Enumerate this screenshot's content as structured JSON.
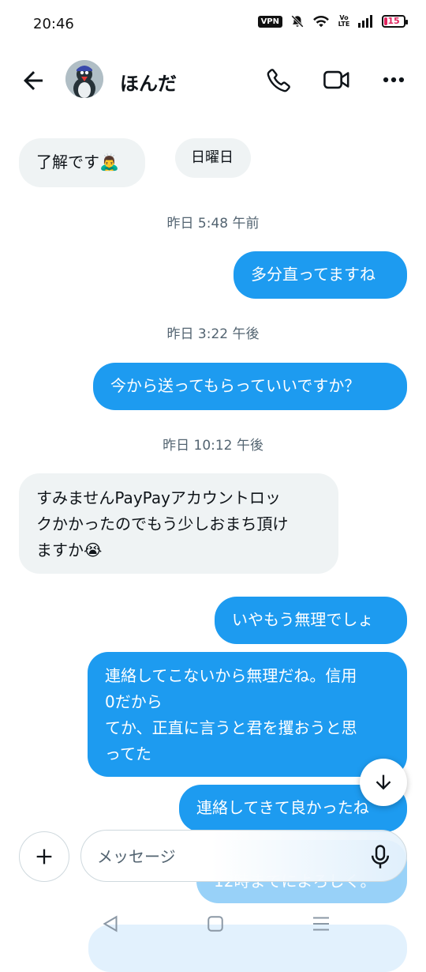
{
  "status_bar": {
    "time": "20:46",
    "vpn_label": "VPN",
    "volte_label": "Vo LTE",
    "battery_level": "15",
    "battery_color": "#e0245e",
    "icons": [
      "vpn-badge",
      "bell-muted-icon",
      "wifi-icon",
      "volte-icon",
      "signal-icon",
      "battery-icon"
    ]
  },
  "header": {
    "back_icon": "arrow-left-icon",
    "contact_name": "ほんだ",
    "call_icon": "phone-icon",
    "video_icon": "video-camera-icon",
    "more_icon": "more-horizontal-icon"
  },
  "messages": [
    {
      "type": "incoming",
      "text": "了解です🙇‍♂️"
    },
    {
      "type": "incoming",
      "text": "日曜日"
    },
    {
      "type": "timestamp",
      "text": "昨日 5:48 午前"
    },
    {
      "type": "outgoing",
      "text": "多分直ってますね"
    },
    {
      "type": "timestamp",
      "text": "昨日 3:22 午後"
    },
    {
      "type": "outgoing",
      "text": "今から送ってもらっていいですか？"
    },
    {
      "type": "timestamp",
      "text": "昨日 10:12 午後"
    },
    {
      "type": "incoming",
      "text": "すみませんPayPayアカウントロッ\nクかかったのでもう少しおまち頂け\nますか😭"
    },
    {
      "type": "outgoing",
      "text": "いやもう無理でしょ"
    },
    {
      "type": "outgoing",
      "text": "連絡してこないから無理だね。信用\n0だから\nてか、正直に言うと君を攫おうと思\nってた"
    },
    {
      "type": "outgoing",
      "text": "連絡してきて良かったね"
    },
    {
      "type": "outgoing",
      "text": "12時までによろしく。"
    }
  ],
  "composer": {
    "add_icon": "plus-icon",
    "placeholder": "メッセージ",
    "value": "",
    "mic_icon": "microphone-icon"
  },
  "scroll_button": {
    "icon": "arrow-down-icon"
  },
  "nav_bar": {
    "icons": [
      "back-triangle-icon",
      "home-square-icon",
      "menu-lines-icon"
    ]
  },
  "colors": {
    "accent": "#1d9bf0",
    "incoming_bubble": "#eff3f4",
    "text": "#0f1419",
    "muted": "#536471"
  }
}
